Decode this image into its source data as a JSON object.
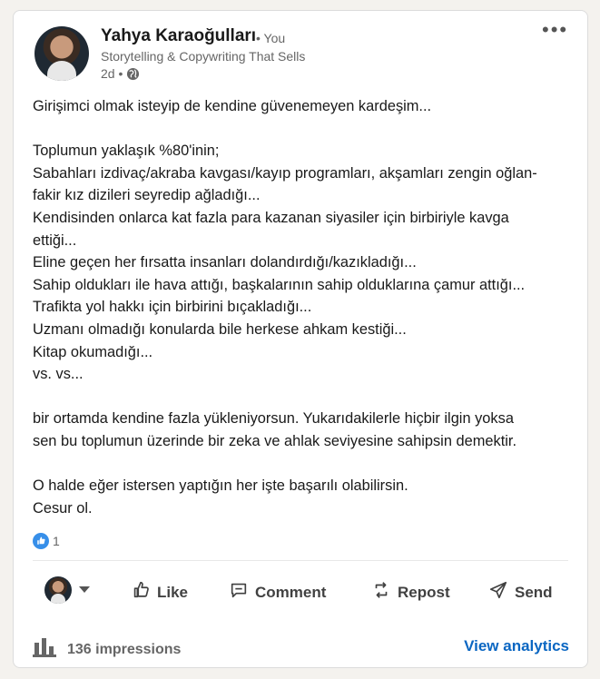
{
  "author": {
    "name": "Yahya Karaoğulları",
    "degree": "• You",
    "headline": "Storytelling & Copywriting That Sells",
    "time": "2d •"
  },
  "post": {
    "lines": [
      "Girişimci olmak isteyip de kendine güvenemeyen kardeşim...",
      "",
      "Toplumun yaklaşık %80'inin;",
      "Sabahları izdivaç/akraba kavgası/kayıp programları, akşamları zengin oğlan-",
      "fakir kız dizileri seyredip ağladığı...",
      "Kendisinden onlarca kat fazla para kazanan siyasiler için birbiriyle kavga",
      "ettiği...",
      "Eline geçen her fırsatta insanları dolandırdığı/kazıkladığı...",
      "Sahip oldukları ile hava attığı, başkalarının sahip olduklarına çamur attığı...",
      "Trafikta yol hakkı için birbirini bıçakladığı...",
      "Uzmanı olmadığı konularda bile herkese ahkam kestiği...",
      "Kitap okumadığı...",
      "vs. vs...",
      "",
      "bir ortamda kendine fazla yükleniyorsun. Yukarıdakilerle hiçbir ilgin yoksa",
      "sen bu toplumun üzerinde bir zeka ve ahlak seviyesine sahipsin demektir.",
      "",
      "O halde eğer istersen yaptığın her işte başarılı olabilirsin.",
      "Cesur ol."
    ]
  },
  "reactions": {
    "count": "1"
  },
  "actions": {
    "like": "Like",
    "comment": "Comment",
    "repost": "Repost",
    "send": "Send"
  },
  "analytics": {
    "impressions": "136 impressions",
    "view_label": "View analytics"
  },
  "colors": {
    "link": "#0a66c2",
    "like_badge": "#378fe9"
  }
}
